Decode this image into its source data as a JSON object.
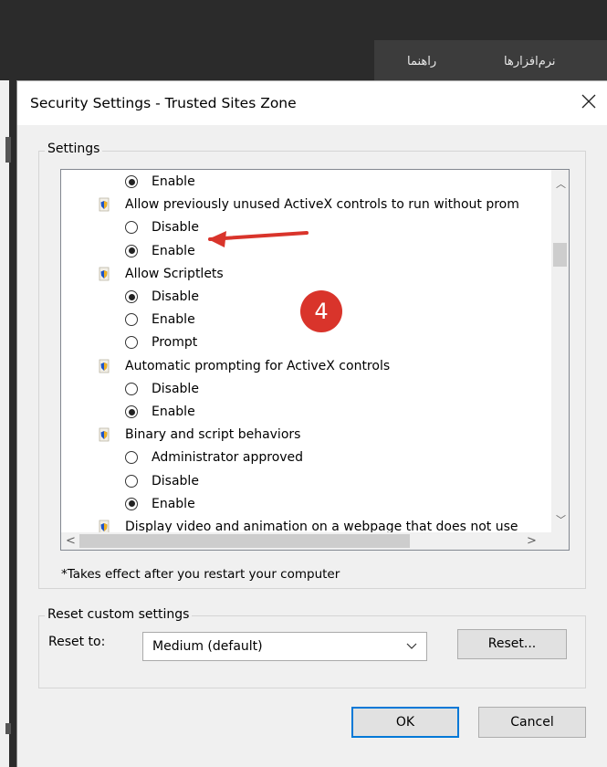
{
  "background": {
    "tabs": [
      "راهنما",
      "نرم‌افزارها"
    ]
  },
  "dialog": {
    "title": "Security Settings - Trusted Sites Zone",
    "close_icon": "close-icon",
    "settings_group_label": "Settings",
    "settings_list": [
      {
        "type": "radio",
        "label": "Enable",
        "checked": true
      },
      {
        "type": "category",
        "label": "Allow previously unused ActiveX controls to run without prom",
        "icon": "shield-icon"
      },
      {
        "type": "radio",
        "label": "Disable",
        "checked": false
      },
      {
        "type": "radio",
        "label": "Enable",
        "checked": true
      },
      {
        "type": "category",
        "label": "Allow Scriptlets",
        "icon": "shield-icon"
      },
      {
        "type": "radio",
        "label": "Disable",
        "checked": true
      },
      {
        "type": "radio",
        "label": "Enable",
        "checked": false
      },
      {
        "type": "radio",
        "label": "Prompt",
        "checked": false
      },
      {
        "type": "category",
        "label": "Automatic prompting for ActiveX controls",
        "icon": "shield-icon"
      },
      {
        "type": "radio",
        "label": "Disable",
        "checked": false
      },
      {
        "type": "radio",
        "label": "Enable",
        "checked": true
      },
      {
        "type": "category",
        "label": "Binary and script behaviors",
        "icon": "shield-icon"
      },
      {
        "type": "radio",
        "label": "Administrator approved",
        "checked": false
      },
      {
        "type": "radio",
        "label": "Disable",
        "checked": false
      },
      {
        "type": "radio",
        "label": "Enable",
        "checked": true
      },
      {
        "type": "category",
        "label": "Display video and animation on a webpage that does not use",
        "icon": "shield-icon"
      }
    ],
    "note": "*Takes effect after you restart your computer",
    "reset_group_label": "Reset custom settings",
    "reset_to_label": "Reset to:",
    "reset_select_value": "Medium (default)",
    "reset_button": "Reset...",
    "ok_button": "OK",
    "cancel_button": "Cancel"
  },
  "annotation": {
    "number": "4",
    "color": "#d9342b"
  }
}
